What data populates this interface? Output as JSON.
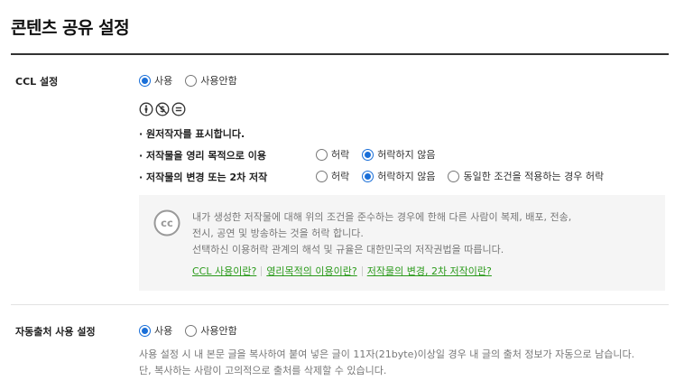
{
  "page": {
    "title": "콘텐츠 공유 설정"
  },
  "ccl": {
    "label": "CCL 설정",
    "use_options": [
      {
        "label": "사용",
        "checked": true
      },
      {
        "label": "사용안함",
        "checked": false
      }
    ],
    "license_icons": [
      "attribution-icon",
      "noncommercial-icon",
      "noderivatives-icon"
    ],
    "attribution_text": "· 원저작자를 표시합니다.",
    "commercial": {
      "label": "· 저작물을 영리 목적으로 이용",
      "options": [
        {
          "label": "허락",
          "checked": false
        },
        {
          "label": "허락하지 않음",
          "checked": true
        }
      ]
    },
    "derivative": {
      "label": "· 저작물의 변경 또는 2차 저작",
      "options": [
        {
          "label": "허락",
          "checked": false
        },
        {
          "label": "허락하지 않음",
          "checked": true
        },
        {
          "label": "동일한 조건을 적용하는 경우 허락",
          "checked": false
        }
      ]
    },
    "info": {
      "badge": "cc",
      "lines": [
        "내가 생성한 저작물에 대해 위의 조건을 준수하는 경우에 한해 다른 사람이 복제, 배포, 전송,",
        "전시, 공연 및 방송하는 것을 허락 합니다.",
        "선택하신 이용허락 관계의 해석 및 규율은 대한민국의 저작권법을 따릅니다."
      ],
      "links": [
        "CCL 사용이란?",
        "영리목적의 이용이란?",
        "저작물의 변경, 2차 저작이란?"
      ]
    }
  },
  "source": {
    "label": "자동출처 사용 설정",
    "options": [
      {
        "label": "사용",
        "checked": true
      },
      {
        "label": "사용안함",
        "checked": false
      }
    ],
    "desc": [
      "사용 설정 시 내 본문 글을 복사하여 붙여 넣은 글이 11자(21byte)이상일 경우 내 글의 출처 정보가 자동으로 남습니다.",
      "단, 복사하는 사람이 고의적으로 출처를 삭제할 수 있습니다."
    ]
  },
  "colors": {
    "accent": "#1a6fd8",
    "link": "#2a9a1a",
    "box_bg": "#f5f5f5"
  }
}
